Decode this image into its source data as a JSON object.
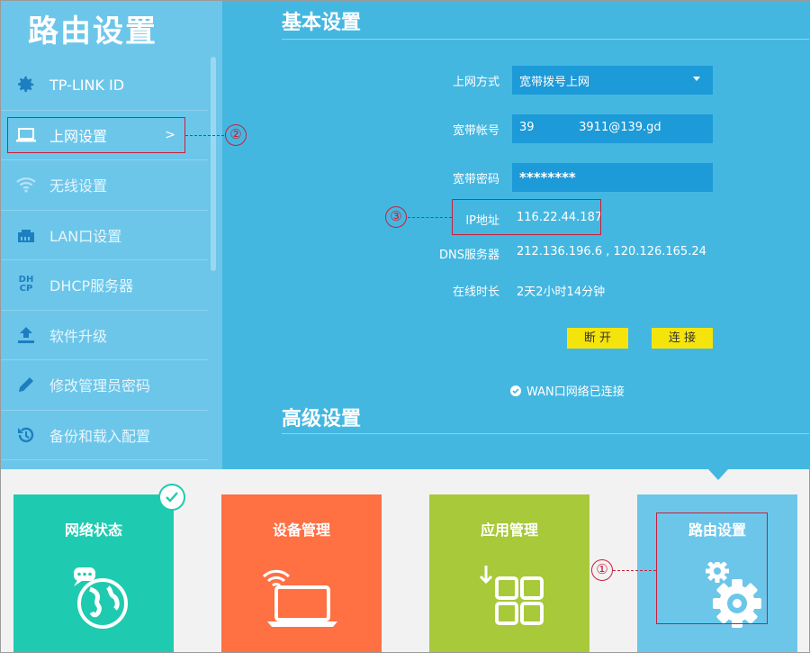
{
  "sidebar": {
    "title": "路由设置",
    "items": [
      {
        "label": "TP-LINK ID",
        "icon": "gear-icon"
      },
      {
        "label": "上网设置",
        "icon": "laptop-icon",
        "arrow": ">"
      },
      {
        "label": "无线设置",
        "icon": "wifi-icon"
      },
      {
        "label": "LAN口设置",
        "icon": "lan-port-icon"
      },
      {
        "label": "DHCP服务器",
        "icon": "dhcp-icon"
      },
      {
        "label": "软件升级",
        "icon": "upload-icon"
      },
      {
        "label": "修改管理员密码",
        "icon": "pencil-icon"
      },
      {
        "label": "备份和载入配置",
        "icon": "history-icon"
      }
    ]
  },
  "main": {
    "basic_title": "基本设置",
    "advanced_title": "高级设置",
    "connection_type_label": "上网方式",
    "connection_type_value": "宽带拨号上网",
    "account_label": "宽带帐号",
    "account_value": "39            3911@139.gd",
    "password_label": "宽带密码",
    "password_value": "********",
    "ip_label": "IP地址",
    "ip_value": "116.22.44.187",
    "dns_label": "DNS服务器",
    "dns_value": "212.136.196.6 , 120.126.165.24",
    "uptime_label": "在线时长",
    "uptime_value": "2天2小时14分钟",
    "disconnect_label": "断 开",
    "connect_label": "连 接",
    "status_text": "WAN口网络已连接"
  },
  "tiles": [
    {
      "label": "网络状态",
      "color": "#1fcbb0",
      "icon": "globe-chat-icon"
    },
    {
      "label": "设备管理",
      "color": "#ff7043",
      "icon": "laptop-wifi-icon"
    },
    {
      "label": "应用管理",
      "color": "#a8c93a",
      "icon": "apps-grid-icon"
    },
    {
      "label": "路由设置",
      "color": "#6cc6ea",
      "icon": "gears-icon"
    }
  ],
  "annotations": [
    "①",
    "②",
    "③"
  ],
  "colors": {
    "sidebar_bg": "#6cc6ea",
    "main_bg": "#44b7e1",
    "field_bg": "#1d9ad8",
    "button_bg": "#f5e40b",
    "annotation": "#c8203c"
  }
}
